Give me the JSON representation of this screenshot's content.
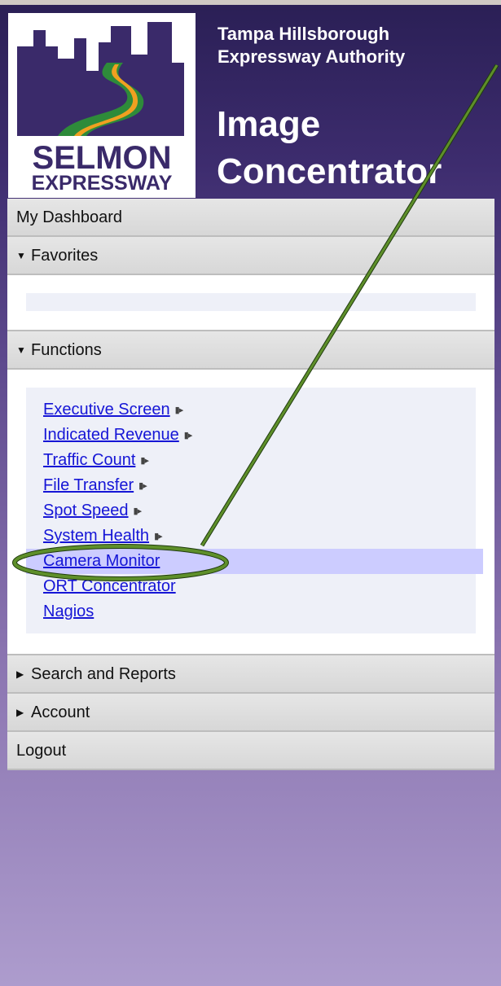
{
  "header": {
    "logo_text_line1": "SELMON",
    "logo_text_line2": "EXPRESSWAY",
    "org_line1": "Tampa Hillsborough",
    "org_line2": "Expressway Authority",
    "app_line1": "Image",
    "app_line2": "Concentrator"
  },
  "nav": {
    "dashboard": "My Dashboard",
    "favorites": "Favorites",
    "functions": "Functions",
    "search_reports": "Search and Reports",
    "account": "Account",
    "logout": "Logout"
  },
  "functions": [
    {
      "label": "Executive Screen",
      "has_arrow": true
    },
    {
      "label": "Indicated Revenue",
      "has_arrow": true
    },
    {
      "label": "Traffic Count",
      "has_arrow": true
    },
    {
      "label": "File Transfer",
      "has_arrow": true
    },
    {
      "label": "Spot Speed",
      "has_arrow": true
    },
    {
      "label": "System Health",
      "has_arrow": true
    },
    {
      "label": "Camera Monitor",
      "has_arrow": false,
      "selected": true
    },
    {
      "label": "ORT Concentrator",
      "has_arrow": false
    },
    {
      "label": "Nagios",
      "has_arrow": false
    }
  ],
  "icons": {
    "expanded": "triangle-down-icon",
    "collapsed": "triangle-right-icon",
    "submenu": "submenu-arrow-icon"
  },
  "colors": {
    "link": "#1515d6",
    "selected_bg": "#ccccff",
    "annotation": "#4a7a1e"
  }
}
